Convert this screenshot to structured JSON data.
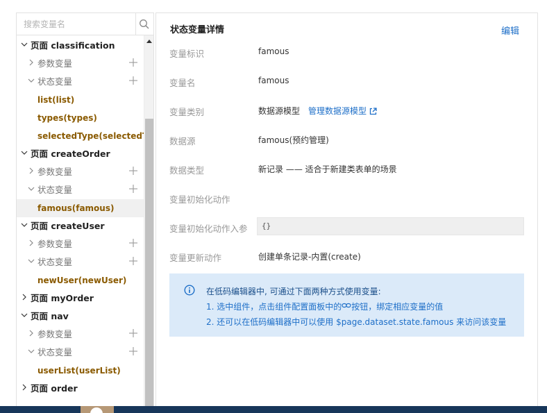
{
  "search": {
    "placeholder": "搜索变量名"
  },
  "tree": [
    {
      "kind": "page",
      "expanded": true,
      "label": "页面 classification"
    },
    {
      "kind": "group",
      "expanded": false,
      "label": "参数变量"
    },
    {
      "kind": "group",
      "expanded": true,
      "label": "状态变量"
    },
    {
      "kind": "var",
      "label": "list(list)"
    },
    {
      "kind": "var",
      "label": "types(types)"
    },
    {
      "kind": "var",
      "label": "selectedType(selectedType)"
    },
    {
      "kind": "page",
      "expanded": true,
      "label": "页面 createOrder"
    },
    {
      "kind": "group",
      "expanded": false,
      "label": "参数变量"
    },
    {
      "kind": "group",
      "expanded": true,
      "label": "状态变量"
    },
    {
      "kind": "var",
      "label": "famous(famous)",
      "selected": true
    },
    {
      "kind": "page",
      "expanded": true,
      "label": "页面 createUser"
    },
    {
      "kind": "group",
      "expanded": false,
      "label": "参数变量"
    },
    {
      "kind": "group",
      "expanded": true,
      "label": "状态变量"
    },
    {
      "kind": "var",
      "label": "newUser(newUser)"
    },
    {
      "kind": "page",
      "expanded": false,
      "label": "页面 myOrder"
    },
    {
      "kind": "page",
      "expanded": true,
      "label": "页面 nav"
    },
    {
      "kind": "group",
      "expanded": false,
      "label": "参数变量"
    },
    {
      "kind": "group",
      "expanded": true,
      "label": "状态变量"
    },
    {
      "kind": "var",
      "label": "userList(userList)"
    },
    {
      "kind": "page",
      "expanded": false,
      "label": "页面 order"
    }
  ],
  "detail": {
    "title": "状态变量详情",
    "edit_label": "编辑",
    "fields": {
      "id_label": "变量标识",
      "id_value": "famous",
      "name_label": "变量名",
      "name_value": "famous",
      "type_label": "变量类别",
      "type_value": "数据源模型",
      "type_link": "管理数据源模型",
      "source_label": "数据源",
      "source_value": "famous(预约管理)",
      "datatype_label": "数据类型",
      "datatype_value": "新记录 —— 适合于新建类表单的场景",
      "init_action_label": "变量初始化动作",
      "init_action_value": "",
      "init_params_label": "变量初始化动作入参",
      "init_params_value": "{}",
      "update_action_label": "变量更新动作",
      "update_action_value": "创建单条记录-内置(create)"
    },
    "info": {
      "line1": "在低码编辑器中, 可通过下面两种方式使用变量:",
      "line2_a": "1. 选中组件，点击组件配置面板中的",
      "line2_b": "按钮，绑定相应变量的值",
      "line3_a": "2. 还可以在低码编辑器中可以使用 ",
      "line3_code": "$page.dataset.state.famous",
      "line3_b": " 来访问该变量"
    }
  },
  "colors": {
    "accent": "#1e6fc8",
    "var_text": "#8a5a00",
    "info_bg": "#dbeaf9"
  }
}
